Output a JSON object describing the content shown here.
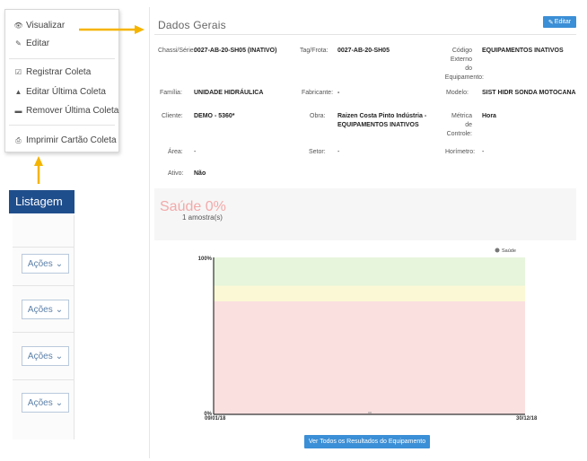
{
  "menu": {
    "items": [
      {
        "icon": "eye-icon",
        "glyph": "👁",
        "label": "Visualizar"
      },
      {
        "icon": "edit-icon",
        "glyph": "✎",
        "label": "Editar"
      },
      {
        "icon": "check-square-icon",
        "glyph": "☑",
        "label": "Registrar Coleta"
      },
      {
        "icon": "warning-icon",
        "glyph": "▲",
        "label": "Editar Última Coleta"
      },
      {
        "icon": "minus-square-icon",
        "glyph": "▬",
        "label": "Remover Última Coleta"
      },
      {
        "icon": "print-icon",
        "glyph": "⎙",
        "label": "Imprimir Cartão Coleta"
      }
    ]
  },
  "listagem": {
    "title": "Listagem",
    "actions_label": "Ações",
    "actions_chevron": "⌄"
  },
  "main": {
    "title": "Dados Gerais",
    "edit_button": "Editar",
    "fields": {
      "chassi_label": "Chassi/Série:",
      "chassi_value": "0027-AB-20-SH05 (INATIVO)",
      "tag_label": "Tag/Frota:",
      "tag_value": "0027-AB-20-SH05",
      "codigo_label_1": "Código",
      "codigo_label_2": "Externo",
      "codigo_label_3": "do",
      "codigo_label_4": "Equipamento:",
      "codigo_value": "EQUIPAMENTOS INATIVOS",
      "familia_label": "Família:",
      "familia_value": "UNIDADE HIDRÁULICA",
      "fabricante_label": "Fabricante:",
      "fabricante_value": "-",
      "modelo_label": "Modelo:",
      "modelo_value": "SIST HIDR SONDA MOTOCANA",
      "cliente_label": "Cliente:",
      "cliente_value": "DEMO - 5360*",
      "obra_label": "Obra:",
      "obra_value_1": "Raizen Costa Pinto Indústria -",
      "obra_value_2": "EQUIPAMENTOS INATIVOS",
      "metrica_label_1": "Métrica",
      "metrica_label_2": "de",
      "metrica_label_3": "Controle:",
      "metrica_value": "Hora",
      "area_label": "Área:",
      "area_value": "-",
      "setor_label": "Setor:",
      "setor_value": "-",
      "horimetro_label": "Horímetro:",
      "horimetro_value": "-",
      "ativo_label": "Ativo:",
      "ativo_value": "Não"
    },
    "saude": {
      "title": "Saúde 0%",
      "subtitle": "1 amostra(s)"
    },
    "results_button": "Ver Todos os Resultados do Equipamento"
  },
  "chart_data": {
    "type": "area",
    "legend": "Saúde",
    "legend_position": "top-right",
    "y_ticks": [
      "100%",
      "0%"
    ],
    "ylim": [
      0,
      100
    ],
    "x_ticks": [
      "09/01/18",
      "30/12/18"
    ],
    "bands": [
      {
        "from": 82,
        "to": 100,
        "color": "#e6f5dc"
      },
      {
        "from": 72,
        "to": 82,
        "color": "#fbf8d6"
      },
      {
        "from": 0,
        "to": 72,
        "color": "#fbe0e0"
      }
    ],
    "series": [
      {
        "values": [
          0
        ]
      }
    ],
    "colors": {
      "legend_dot": "#777777",
      "axis": "#333333"
    }
  }
}
